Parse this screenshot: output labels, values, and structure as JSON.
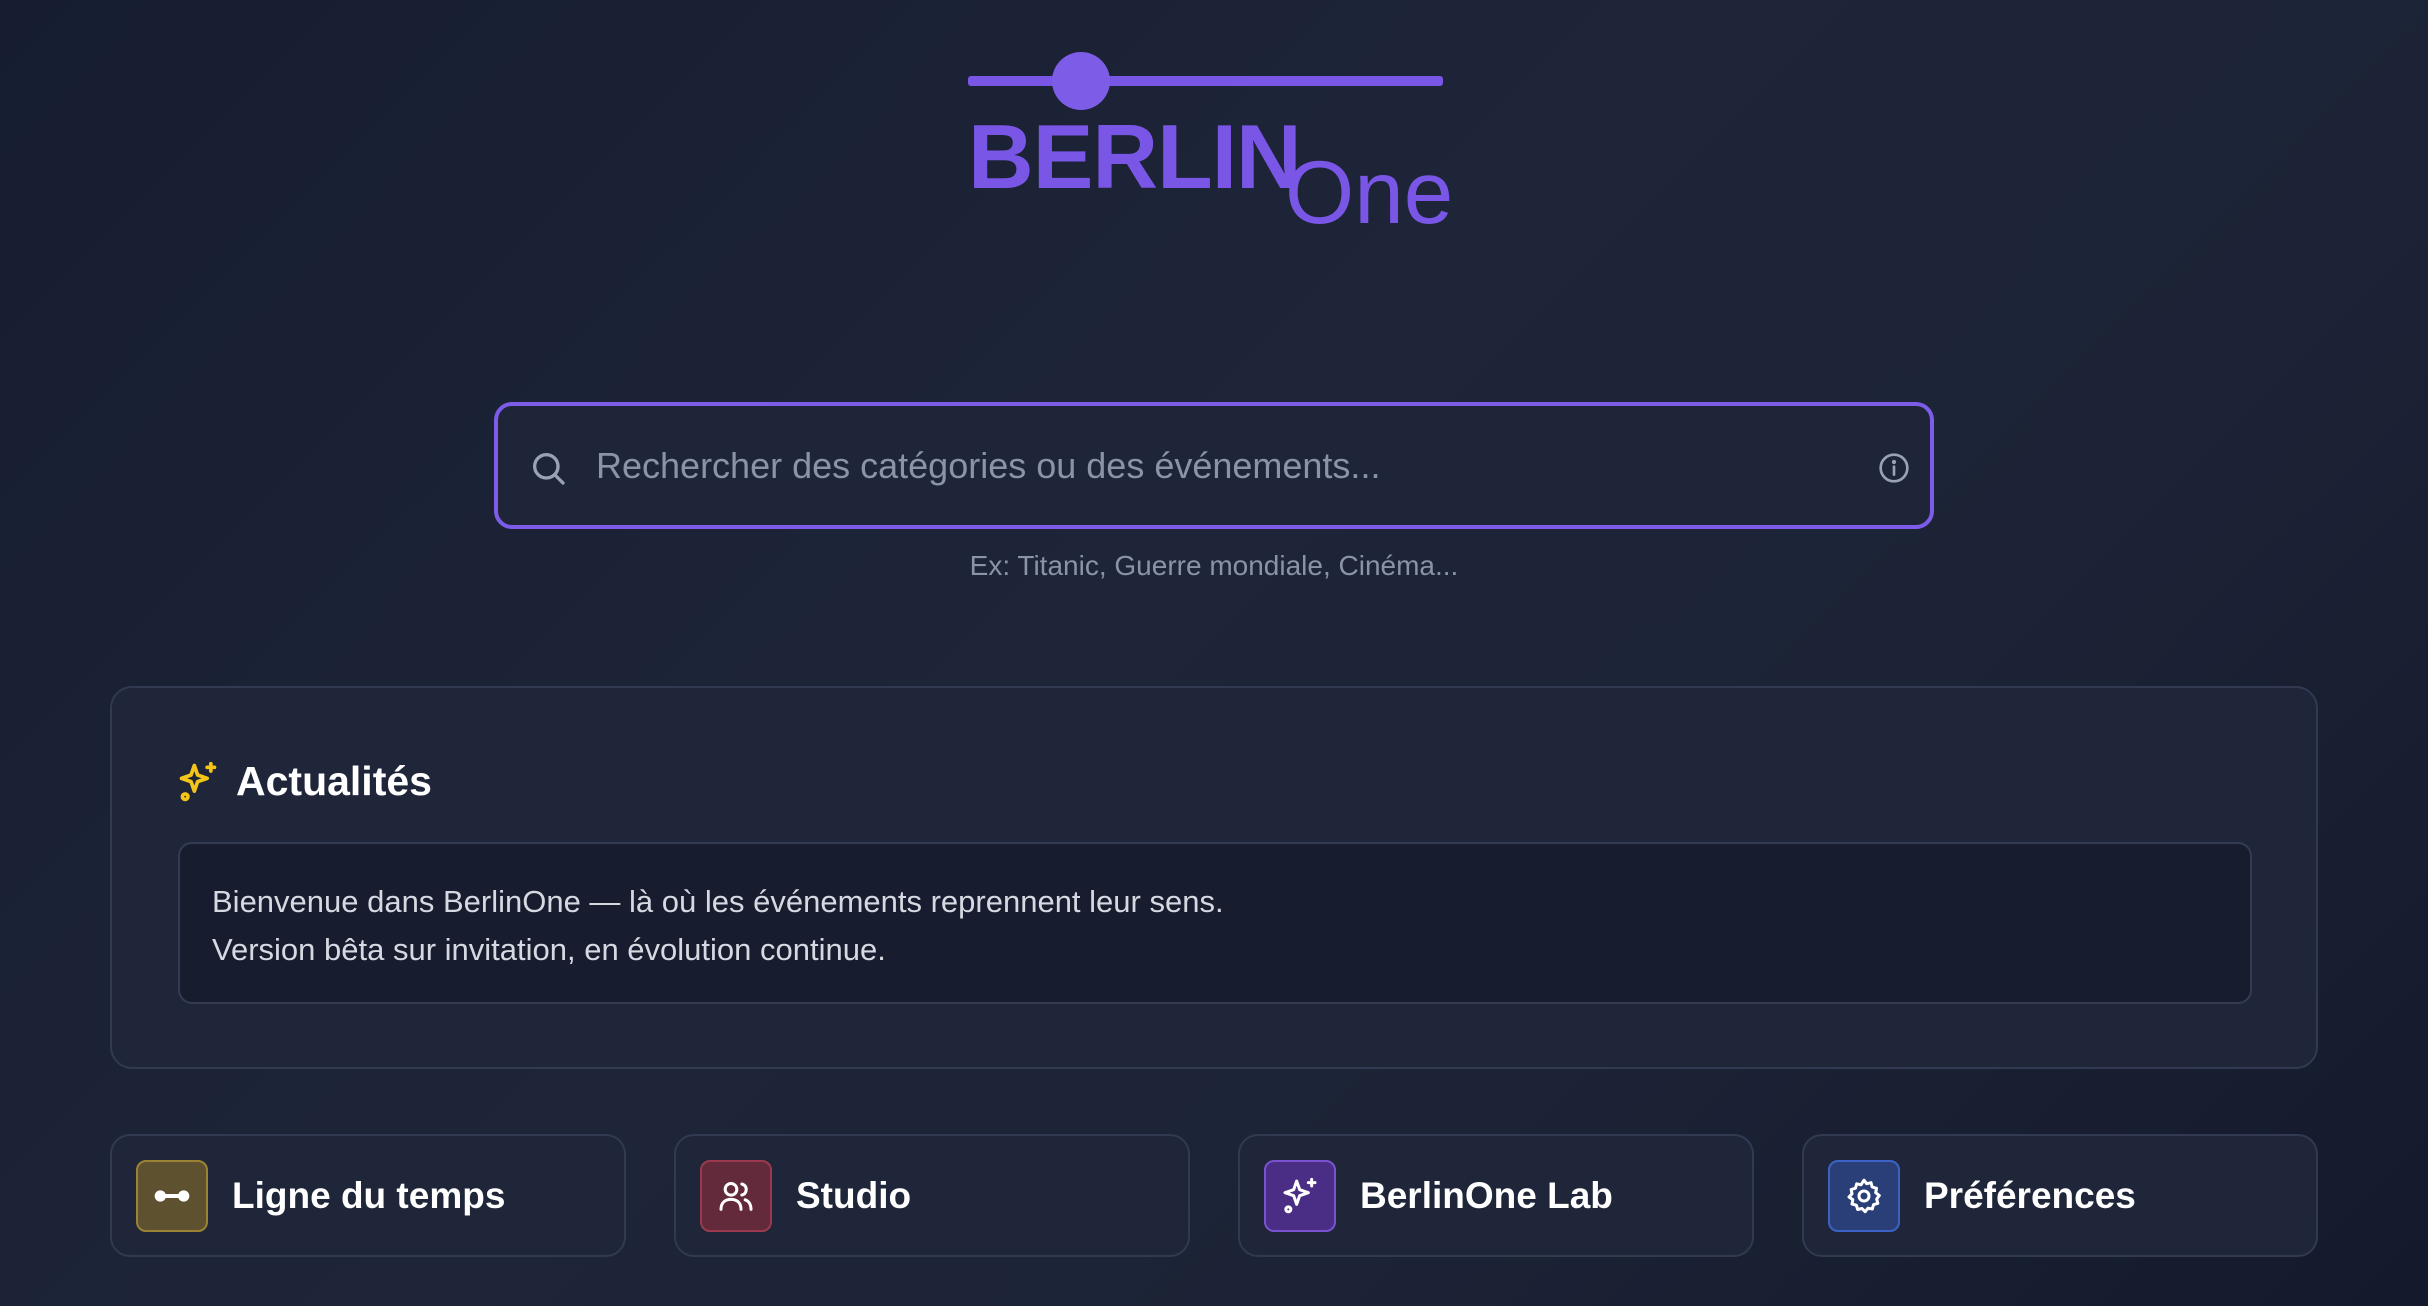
{
  "logo": {
    "word_main": "BERLIN",
    "word_sub": "One",
    "color": "#7a56e6"
  },
  "search": {
    "placeholder": "Rechercher des catégories ou des événements...",
    "value": "",
    "hint": "Ex: Titanic, Guerre mondiale, Cinéma...",
    "icon": "search-icon",
    "info_icon": "info-icon",
    "border_color": "#7d5ce8"
  },
  "news": {
    "title": "Actualités",
    "icon": "sparkle-icon",
    "icon_color": "#f5c518",
    "lines": [
      "Bienvenue dans BerlinOne — là où les événements reprennent leur sens.",
      "Version bêta sur invitation, en évolution continue."
    ]
  },
  "nav": [
    {
      "label": "Ligne du temps",
      "icon": "timeline-icon",
      "accent": "#9a8332"
    },
    {
      "label": "Studio",
      "icon": "users-icon",
      "accent": "#9b3a4f"
    },
    {
      "label": "BerlinOne Lab",
      "icon": "sparkle-icon",
      "accent": "#7a52d0"
    },
    {
      "label": "Préférences",
      "icon": "gear-icon",
      "accent": "#3c62c4"
    }
  ]
}
